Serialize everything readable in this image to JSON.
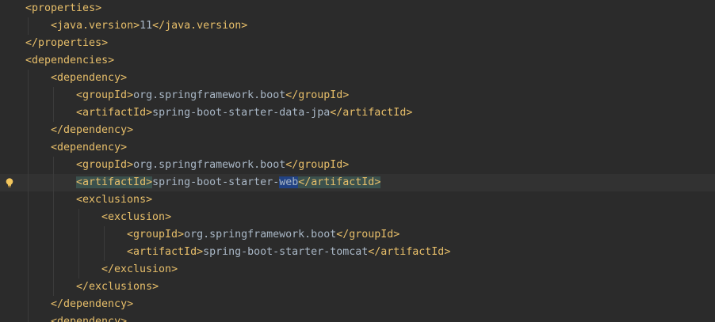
{
  "colors": {
    "background": "#2b2b2b",
    "tag": "#e8bf6a",
    "text": "#a9b7c6",
    "tag_match_highlight": "#3b514d",
    "word_highlight": "#214283",
    "current_line": "#323232"
  },
  "gutter": {
    "intention_icon": "lightbulb-icon"
  },
  "lines": [
    {
      "indent": 0,
      "tokens": [
        {
          "t": "<",
          "k": "br"
        },
        {
          "t": "properties",
          "k": "tag"
        },
        {
          "t": ">",
          "k": "br"
        }
      ]
    },
    {
      "indent": 1,
      "tokens": [
        {
          "t": "<",
          "k": "br"
        },
        {
          "t": "java.version",
          "k": "tag"
        },
        {
          "t": ">",
          "k": "br"
        },
        {
          "t": "11",
          "k": "txt"
        },
        {
          "t": "</",
          "k": "br"
        },
        {
          "t": "java.version",
          "k": "tag"
        },
        {
          "t": ">",
          "k": "br"
        }
      ]
    },
    {
      "indent": 0,
      "tokens": [
        {
          "t": "</",
          "k": "br"
        },
        {
          "t": "properties",
          "k": "tag"
        },
        {
          "t": ">",
          "k": "br"
        }
      ]
    },
    {
      "indent": 0,
      "tokens": [
        {
          "t": "<",
          "k": "br"
        },
        {
          "t": "dependencies",
          "k": "tag"
        },
        {
          "t": ">",
          "k": "br"
        }
      ]
    },
    {
      "indent": 1,
      "tokens": [
        {
          "t": "<",
          "k": "br"
        },
        {
          "t": "dependency",
          "k": "tag"
        },
        {
          "t": ">",
          "k": "br"
        }
      ]
    },
    {
      "indent": 2,
      "tokens": [
        {
          "t": "<",
          "k": "br"
        },
        {
          "t": "groupId",
          "k": "tag"
        },
        {
          "t": ">",
          "k": "br"
        },
        {
          "t": "org.springframework.boot",
          "k": "txt"
        },
        {
          "t": "</",
          "k": "br"
        },
        {
          "t": "groupId",
          "k": "tag"
        },
        {
          "t": ">",
          "k": "br"
        }
      ]
    },
    {
      "indent": 2,
      "tokens": [
        {
          "t": "<",
          "k": "br"
        },
        {
          "t": "artifactId",
          "k": "tag"
        },
        {
          "t": ">",
          "k": "br"
        },
        {
          "t": "spring-boot-starter-data-jpa",
          "k": "txt"
        },
        {
          "t": "</",
          "k": "br"
        },
        {
          "t": "artifactId",
          "k": "tag"
        },
        {
          "t": ">",
          "k": "br"
        }
      ]
    },
    {
      "indent": 1,
      "tokens": [
        {
          "t": "</",
          "k": "br"
        },
        {
          "t": "dependency",
          "k": "tag"
        },
        {
          "t": ">",
          "k": "br"
        }
      ]
    },
    {
      "indent": 1,
      "tokens": [
        {
          "t": "<",
          "k": "br"
        },
        {
          "t": "dependency",
          "k": "tag"
        },
        {
          "t": ">",
          "k": "br"
        }
      ]
    },
    {
      "indent": 2,
      "tokens": [
        {
          "t": "<",
          "k": "br"
        },
        {
          "t": "groupId",
          "k": "tag"
        },
        {
          "t": ">",
          "k": "br"
        },
        {
          "t": "org.springframework.boot",
          "k": "txt"
        },
        {
          "t": "</",
          "k": "br"
        },
        {
          "t": "groupId",
          "k": "tag"
        },
        {
          "t": ">",
          "k": "br"
        }
      ]
    },
    {
      "indent": 2,
      "current": true,
      "bulb": true,
      "tokens": [
        {
          "t": "<",
          "k": "br",
          "h": "match"
        },
        {
          "t": "artifactId",
          "k": "tag",
          "h": "match"
        },
        {
          "t": ">",
          "k": "br",
          "h": "match"
        },
        {
          "t": "spring-boot-starter-",
          "k": "txt"
        },
        {
          "t": "web",
          "k": "txt",
          "h": "sel"
        },
        {
          "t": "</",
          "k": "br",
          "h": "match"
        },
        {
          "t": "artifactId",
          "k": "tag",
          "h": "match"
        },
        {
          "t": ">",
          "k": "br",
          "h": "match"
        }
      ]
    },
    {
      "indent": 2,
      "tokens": [
        {
          "t": "<",
          "k": "br"
        },
        {
          "t": "exclusions",
          "k": "tag"
        },
        {
          "t": ">",
          "k": "br"
        }
      ]
    },
    {
      "indent": 3,
      "tokens": [
        {
          "t": "<",
          "k": "br"
        },
        {
          "t": "exclusion",
          "k": "tag"
        },
        {
          "t": ">",
          "k": "br"
        }
      ]
    },
    {
      "indent": 4,
      "tokens": [
        {
          "t": "<",
          "k": "br"
        },
        {
          "t": "groupId",
          "k": "tag"
        },
        {
          "t": ">",
          "k": "br"
        },
        {
          "t": "org.springframework.boot",
          "k": "txt"
        },
        {
          "t": "</",
          "k": "br"
        },
        {
          "t": "groupId",
          "k": "tag"
        },
        {
          "t": ">",
          "k": "br"
        }
      ]
    },
    {
      "indent": 4,
      "tokens": [
        {
          "t": "<",
          "k": "br"
        },
        {
          "t": "artifactId",
          "k": "tag"
        },
        {
          "t": ">",
          "k": "br"
        },
        {
          "t": "spring-boot-starter-tomcat",
          "k": "txt"
        },
        {
          "t": "</",
          "k": "br"
        },
        {
          "t": "artifactId",
          "k": "tag"
        },
        {
          "t": ">",
          "k": "br"
        }
      ]
    },
    {
      "indent": 3,
      "tokens": [
        {
          "t": "</",
          "k": "br"
        },
        {
          "t": "exclusion",
          "k": "tag"
        },
        {
          "t": ">",
          "k": "br"
        }
      ]
    },
    {
      "indent": 2,
      "tokens": [
        {
          "t": "</",
          "k": "br"
        },
        {
          "t": "exclusions",
          "k": "tag"
        },
        {
          "t": ">",
          "k": "br"
        }
      ]
    },
    {
      "indent": 1,
      "tokens": [
        {
          "t": "</",
          "k": "br"
        },
        {
          "t": "dependency",
          "k": "tag"
        },
        {
          "t": ">",
          "k": "br"
        }
      ]
    },
    {
      "indent": 1,
      "tokens": [
        {
          "t": "<",
          "k": "br"
        },
        {
          "t": "dependency",
          "k": "tag"
        },
        {
          "t": ">",
          "k": "br"
        }
      ]
    }
  ]
}
